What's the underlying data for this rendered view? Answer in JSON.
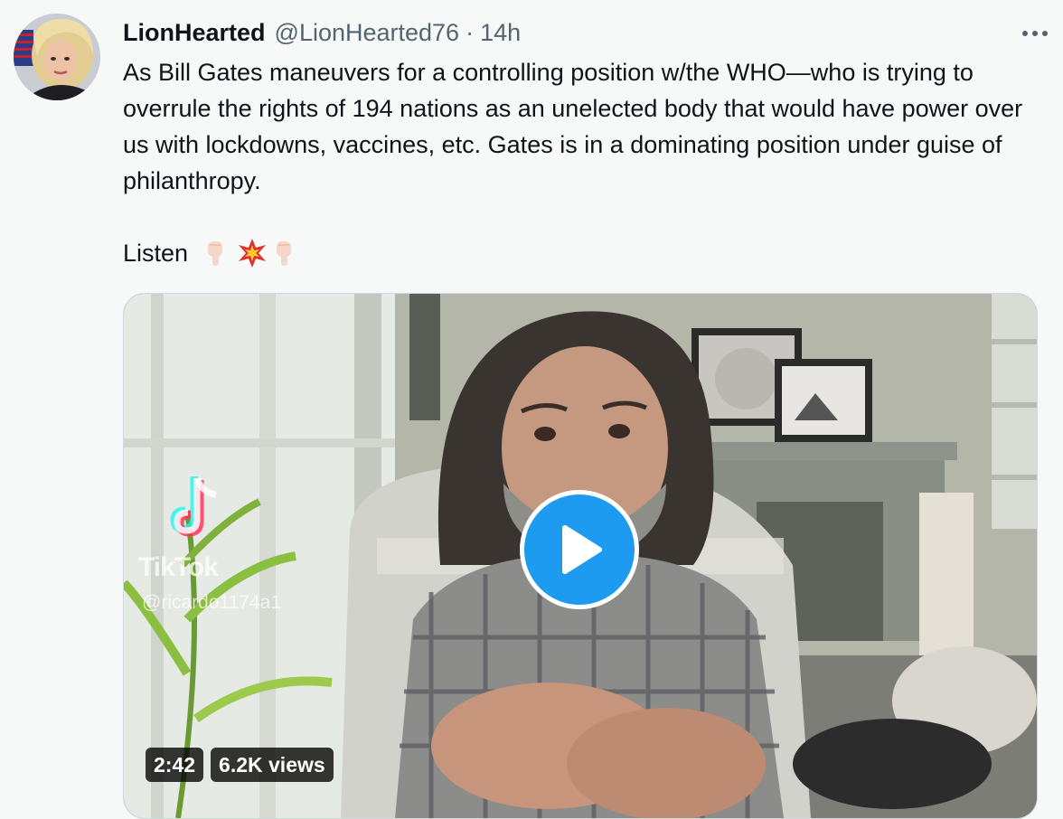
{
  "tweet": {
    "display_name": "LionHearted",
    "handle": "@LionHearted76",
    "separator": "·",
    "time": "14h",
    "text_paragraph": "As Bill Gates maneuvers for a controlling position w/the WHO—who is trying to overrule the rights of 194 nations as an unelected body that would have power over us with lockdowns, vaccines, etc. Gates is in a dominating position under guise of philanthropy.",
    "listen_label": "Listen",
    "emojis": [
      "point-down-icon",
      "collision-icon",
      "point-down-icon"
    ]
  },
  "media": {
    "duration": "2:42",
    "views": "6.2K views",
    "watermark_name": "TikTok",
    "watermark_handle": "@ricardo1174a1"
  },
  "colors": {
    "accent": "#1d9bf0",
    "text_primary": "#0f1419",
    "text_secondary": "#536471",
    "background": "#f7f9f9"
  }
}
